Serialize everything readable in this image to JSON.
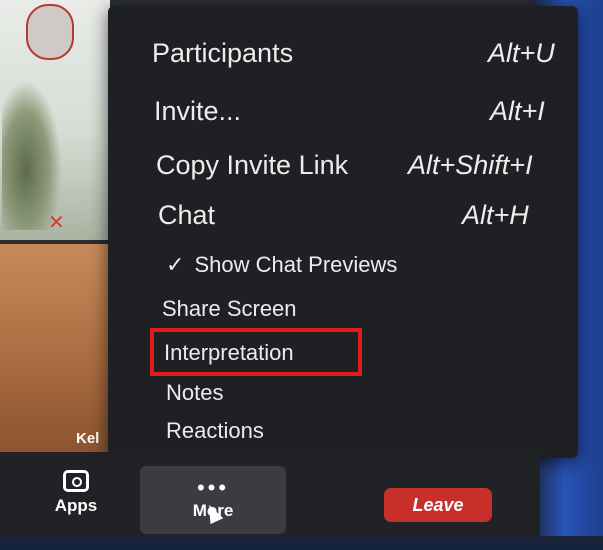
{
  "menu": {
    "items": [
      {
        "label": "Participants",
        "shortcut": "Alt+U"
      },
      {
        "label": "Invite...",
        "shortcut": "Alt+I"
      },
      {
        "label": "Copy Invite Link",
        "shortcut": "Alt+Shift+I"
      },
      {
        "label": "Chat",
        "shortcut": "Alt+H"
      }
    ],
    "show_chat_previews": {
      "label": "Show Chat Previews",
      "checked": true,
      "check_glyph": "✓"
    },
    "share_screen": "Share Screen",
    "interpretation": "Interpretation",
    "notes": "Notes",
    "reactions": "Reactions"
  },
  "video": {
    "participant_name": "Kel"
  },
  "toolbar": {
    "apps_label": "Apps",
    "more_label": "More",
    "more_dots": "•••",
    "leave_label": "Leave"
  },
  "colors": {
    "highlight": "#e31b1b",
    "leave": "#c62f2a",
    "menu_bg": "#1f2024"
  }
}
